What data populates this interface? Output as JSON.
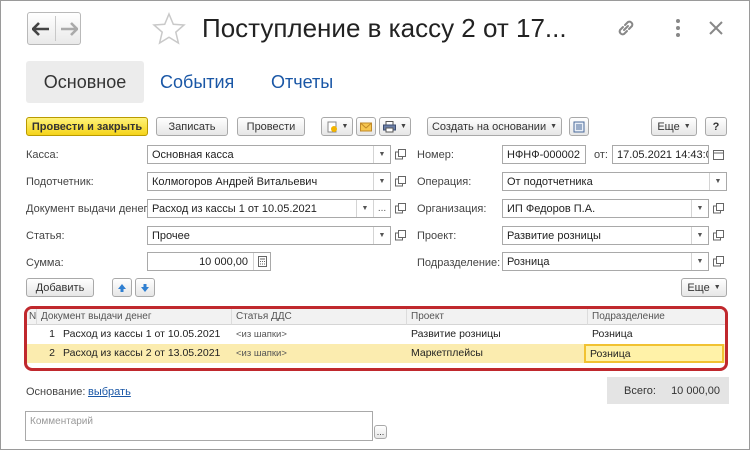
{
  "window": {
    "title": "Поступление в кассу 2 от 17...",
    "accent_link_color": "#1a57a6",
    "highlight_color": "#c0282d"
  },
  "nav": {
    "back_icon": "arrow-left",
    "forward_icon": "arrow-right",
    "star_icon": "star-outline"
  },
  "title_icons": {
    "link": "link-icon",
    "more": "more-vertical-icon",
    "close": "close-icon"
  },
  "tabs": [
    {
      "label": "Основное",
      "active": true
    },
    {
      "label": "События",
      "active": false
    },
    {
      "label": "Отчеты",
      "active": false
    }
  ],
  "toolbar": {
    "post_and_close": "Провести и закрыть",
    "save": "Записать",
    "post": "Провести",
    "create_based_on": "Создать на основании",
    "more": "Еще",
    "help": "?"
  },
  "form": {
    "kassa_label": "Касса:",
    "kassa_value": "Основная касса",
    "podotchetnik_label": "Подотчетник:",
    "podotchetnik_value": "Колмогоров Андрей Витальевич",
    "doc_label": "Документ выдачи денег:",
    "doc_value": "Расход из кассы 1 от 10.05.2021",
    "statya_label": "Статья:",
    "statya_value": "Прочее",
    "summa_label": "Сумма:",
    "summa_value": "10 000,00",
    "nomer_label": "Номер:",
    "nomer_value": "НФНФ-000002",
    "ot_label": "от:",
    "date_value": "17.05.2021 14:43:0",
    "operation_label": "Операция:",
    "operation_value": "От подотчетника",
    "org_label": "Организация:",
    "org_value": "ИП Федоров П.А.",
    "project_label": "Проект:",
    "project_value": "Развитие розницы",
    "division_label": "Подразделение:",
    "division_value": "Розница",
    "ellipsis": "..."
  },
  "table_toolbar": {
    "add": "Добавить",
    "more": "Еще"
  },
  "table": {
    "headers": [
      "N",
      "Документ выдачи денег",
      "Статья ДДС",
      "Проект",
      "Подразделение"
    ],
    "rows": [
      {
        "n": "1",
        "doc": "Расход из кассы 1 от 10.05.2021",
        "article": "<из шапки>",
        "project": "Развитие розницы",
        "division": "Розница"
      },
      {
        "n": "2",
        "doc": "Расход из кассы 2 от 13.05.2021",
        "article": "<из шапки>",
        "project": "Маркетплейсы",
        "division": "Розница"
      }
    ],
    "selected_row_index": 1
  },
  "footer": {
    "basis_label": "Основание:",
    "basis_link": "выбрать",
    "total_label": "Всего:",
    "total_value": "10 000,00",
    "comment_placeholder": "Комментарий",
    "comment_button": "..."
  }
}
